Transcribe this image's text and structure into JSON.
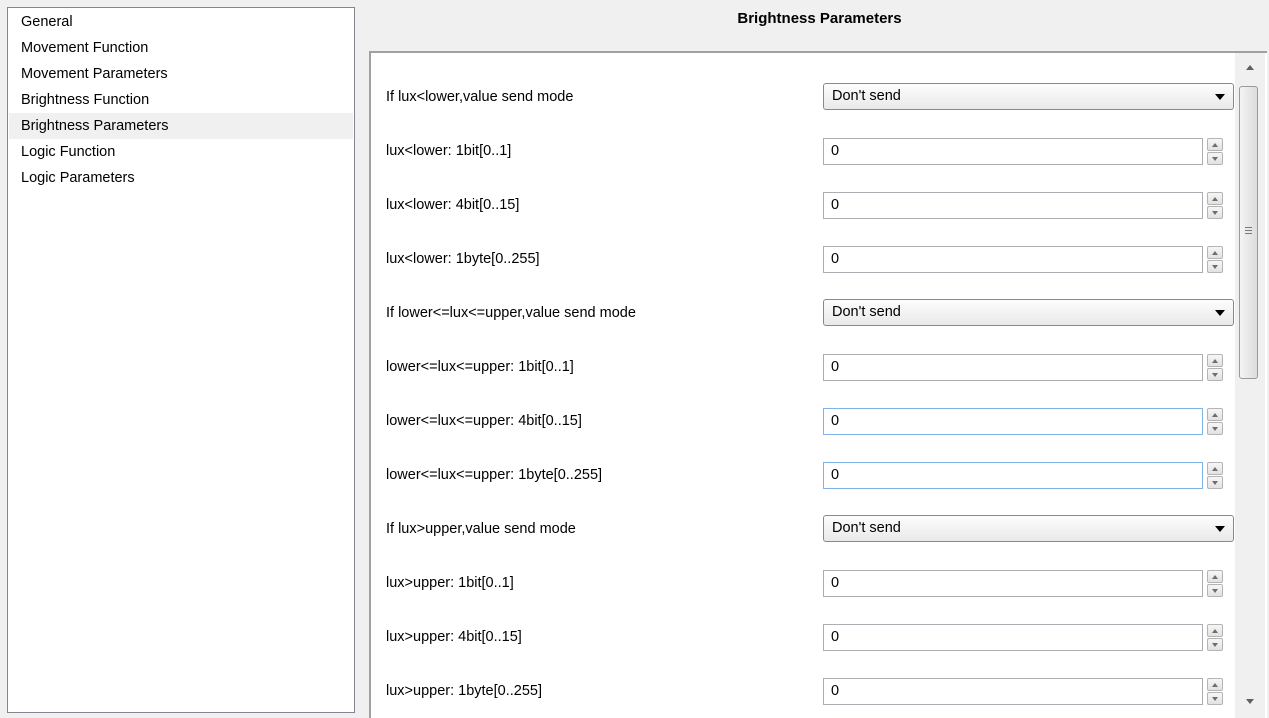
{
  "nav": {
    "items": [
      {
        "label": "General"
      },
      {
        "label": "Movement Function"
      },
      {
        "label": "Movement Parameters"
      },
      {
        "label": "Brightness Function"
      },
      {
        "label": "Brightness Parameters",
        "selected": true
      },
      {
        "label": "Logic Function"
      },
      {
        "label": "Logic Parameters"
      }
    ]
  },
  "page": {
    "title": "Brightness Parameters"
  },
  "params": [
    {
      "label": "If lux<lower,value send mode",
      "type": "dropdown",
      "value": "Don't send"
    },
    {
      "label": "lux<lower: 1bit[0..1]",
      "type": "number",
      "value": "0"
    },
    {
      "label": "lux<lower: 4bit[0..15]",
      "type": "number",
      "value": "0"
    },
    {
      "label": "lux<lower: 1byte[0..255]",
      "type": "number",
      "value": "0"
    },
    {
      "label": "If lower<=lux<=upper,value send mode",
      "type": "dropdown",
      "value": "Don't send"
    },
    {
      "label": "lower<=lux<=upper: 1bit[0..1]",
      "type": "number",
      "value": "0"
    },
    {
      "label": "lower<=lux<=upper: 4bit[0..15]",
      "type": "number",
      "value": "0"
    },
    {
      "label": "lower<=lux<=upper: 1byte[0..255]",
      "type": "number",
      "value": "0"
    },
    {
      "label": "If lux>upper,value send mode",
      "type": "dropdown",
      "value": "Don't send"
    },
    {
      "label": "lux>upper: 1bit[0..1]",
      "type": "number",
      "value": "0"
    },
    {
      "label": "lux>upper: 4bit[0..15]",
      "type": "number",
      "value": "0"
    },
    {
      "label": "lux>upper: 1byte[0..255]",
      "type": "number",
      "value": "0"
    }
  ]
}
